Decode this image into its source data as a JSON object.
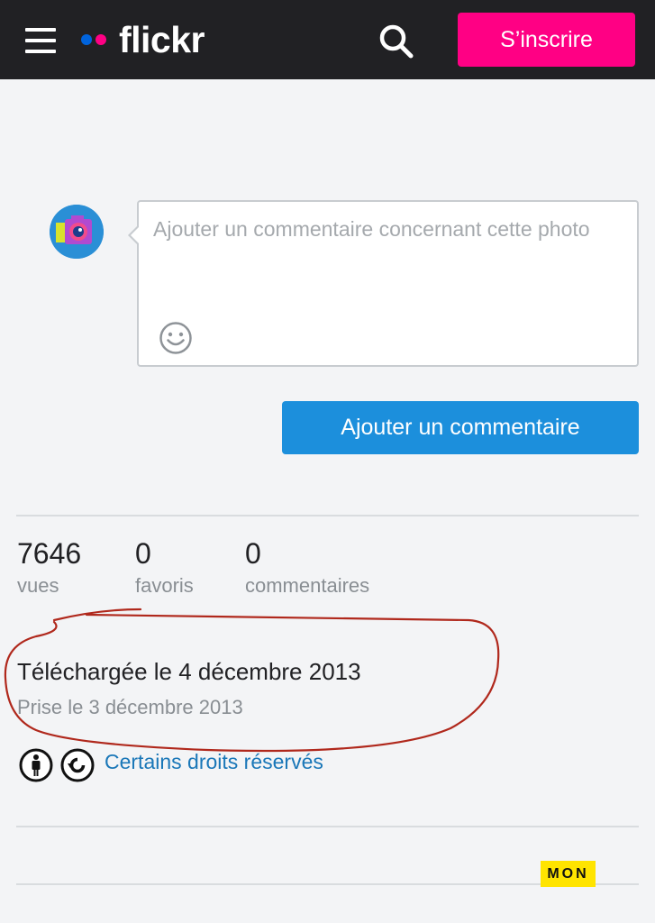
{
  "header": {
    "logo_text": "flickr",
    "signup_label": "S’inscrire"
  },
  "comment": {
    "placeholder": "Ajouter un commentaire concernant cette photo",
    "submit_label": "Ajouter un commentaire"
  },
  "stats": [
    {
      "value": "7646",
      "label": "vues"
    },
    {
      "value": "0",
      "label": "favoris"
    },
    {
      "value": "0",
      "label": "commentaires"
    }
  ],
  "dates": {
    "uploaded": "Téléchargée le 4 décembre 2013",
    "taken": "Prise le 3 décembre 2013"
  },
  "license": {
    "link_text": "Certains droits réservés",
    "icons": [
      "cc-attribution-icon",
      "cc-share-alike-icon"
    ]
  },
  "watermark": "MON",
  "colors": {
    "header_bg": "#212124",
    "signup_bg": "#ff0084",
    "button_blue": "#1c8fdc",
    "link_blue": "#1a77b8",
    "annotation_red": "#b0281c",
    "flickr_blue_dot": "#0063dc",
    "flickr_pink_dot": "#ff0084"
  }
}
